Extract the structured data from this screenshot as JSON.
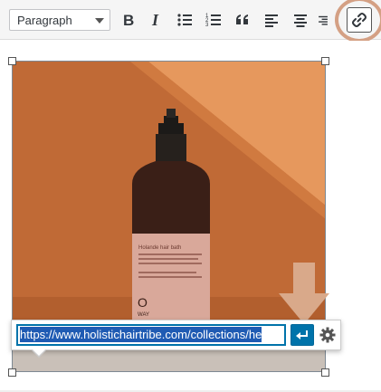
{
  "toolbar": {
    "format_select": {
      "value": "Paragraph"
    },
    "buttons": [
      {
        "name": "bold",
        "icon": "bold-icon"
      },
      {
        "name": "italic",
        "icon": "italic-icon"
      },
      {
        "name": "bulleted-list",
        "icon": "bulleted-list-icon"
      },
      {
        "name": "numbered-list",
        "icon": "numbered-list-icon"
      },
      {
        "name": "blockquote",
        "icon": "blockquote-icon"
      },
      {
        "name": "align-left",
        "icon": "align-left-icon"
      },
      {
        "name": "align-center",
        "icon": "align-center-icon"
      },
      {
        "name": "align-right",
        "icon": "align-right-icon"
      },
      {
        "name": "insert-link",
        "icon": "link-icon",
        "active": true
      }
    ]
  },
  "image": {
    "bottle_label": "Holande hair bath",
    "bottle_logo": "O",
    "bottle_brand": "WAY"
  },
  "link_popup": {
    "url_value": "https://www.holistichairtribe.com/collections/he",
    "apply_icon": "enter-arrow-icon",
    "settings_icon": "gear-icon"
  },
  "colors": {
    "accent": "#0073aa",
    "highlight": "#d4a084",
    "background_orange": "#c8703a"
  }
}
